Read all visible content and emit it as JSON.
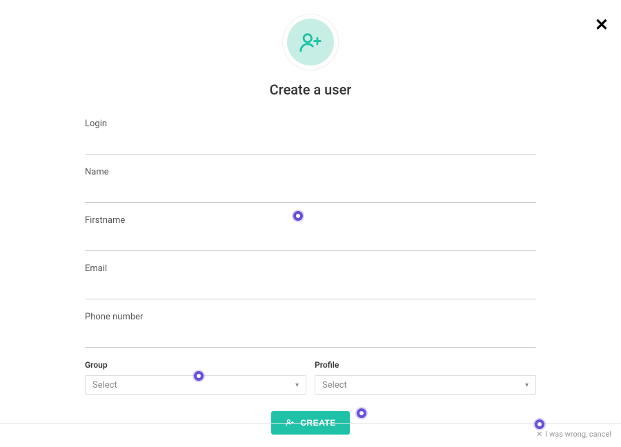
{
  "header": {
    "title": "Create a user"
  },
  "fields": {
    "login": {
      "label": "Login",
      "value": ""
    },
    "name": {
      "label": "Name",
      "value": ""
    },
    "firstname": {
      "label": "Firstname",
      "value": ""
    },
    "email": {
      "label": "Email",
      "value": ""
    },
    "phone": {
      "label": "Phone number",
      "value": ""
    }
  },
  "selects": {
    "group": {
      "label": "Group",
      "placeholder": "Select"
    },
    "profile": {
      "label": "Profile",
      "placeholder": "Select"
    }
  },
  "actions": {
    "create_label": "CREATE",
    "cancel_label": "I was wrong, cancel"
  }
}
